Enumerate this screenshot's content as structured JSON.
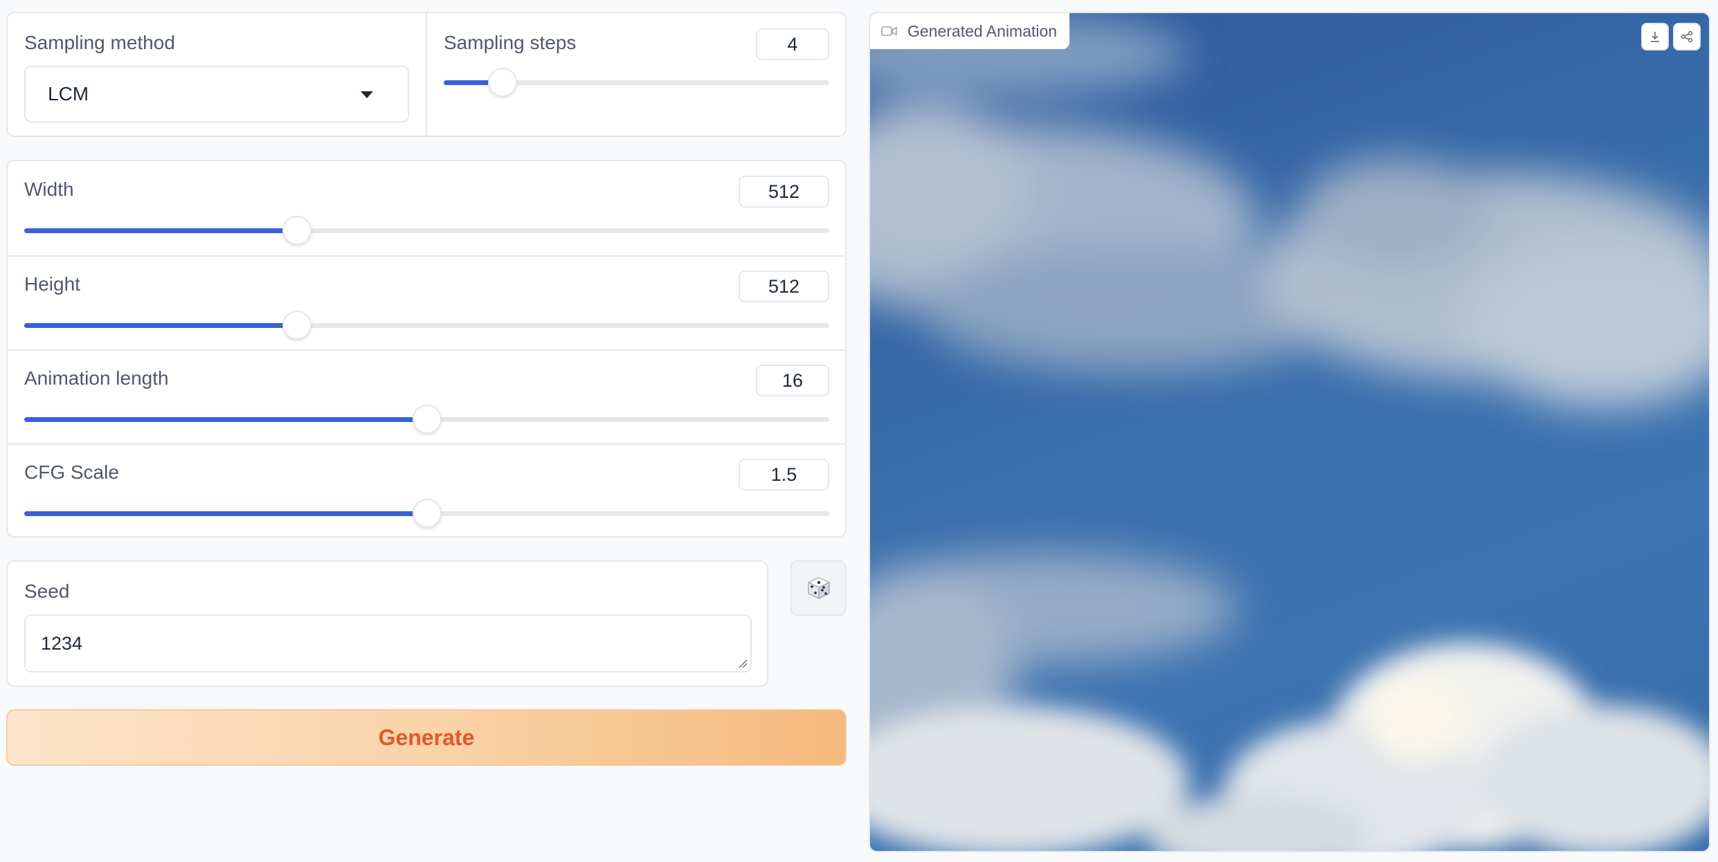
{
  "sampling": {
    "method_label": "Sampling method",
    "method_value": "LCM",
    "steps_label": "Sampling steps",
    "steps_value": "4",
    "steps_fraction": 0.152
  },
  "size": {
    "width_label": "Width",
    "width_value": "512",
    "width_fraction": 0.339,
    "height_label": "Height",
    "height_value": "512",
    "height_fraction": 0.339,
    "length_label": "Animation length",
    "length_value": "16",
    "length_fraction": 0.5,
    "cfg_label": "CFG Scale",
    "cfg_value": "1.5",
    "cfg_fraction": 0.5
  },
  "seed": {
    "label": "Seed",
    "value": "1234",
    "random_icon": "dice-icon"
  },
  "actions": {
    "generate_label": "Generate"
  },
  "output": {
    "label": "Generated Animation",
    "label_icon": "video-camera-icon",
    "download_icon": "download-icon",
    "share_icon": "share-icon"
  },
  "colors": {
    "accent": "#3b5fdb",
    "generate_text": "#e0592a",
    "generate_bg": "#f9d1a5"
  }
}
